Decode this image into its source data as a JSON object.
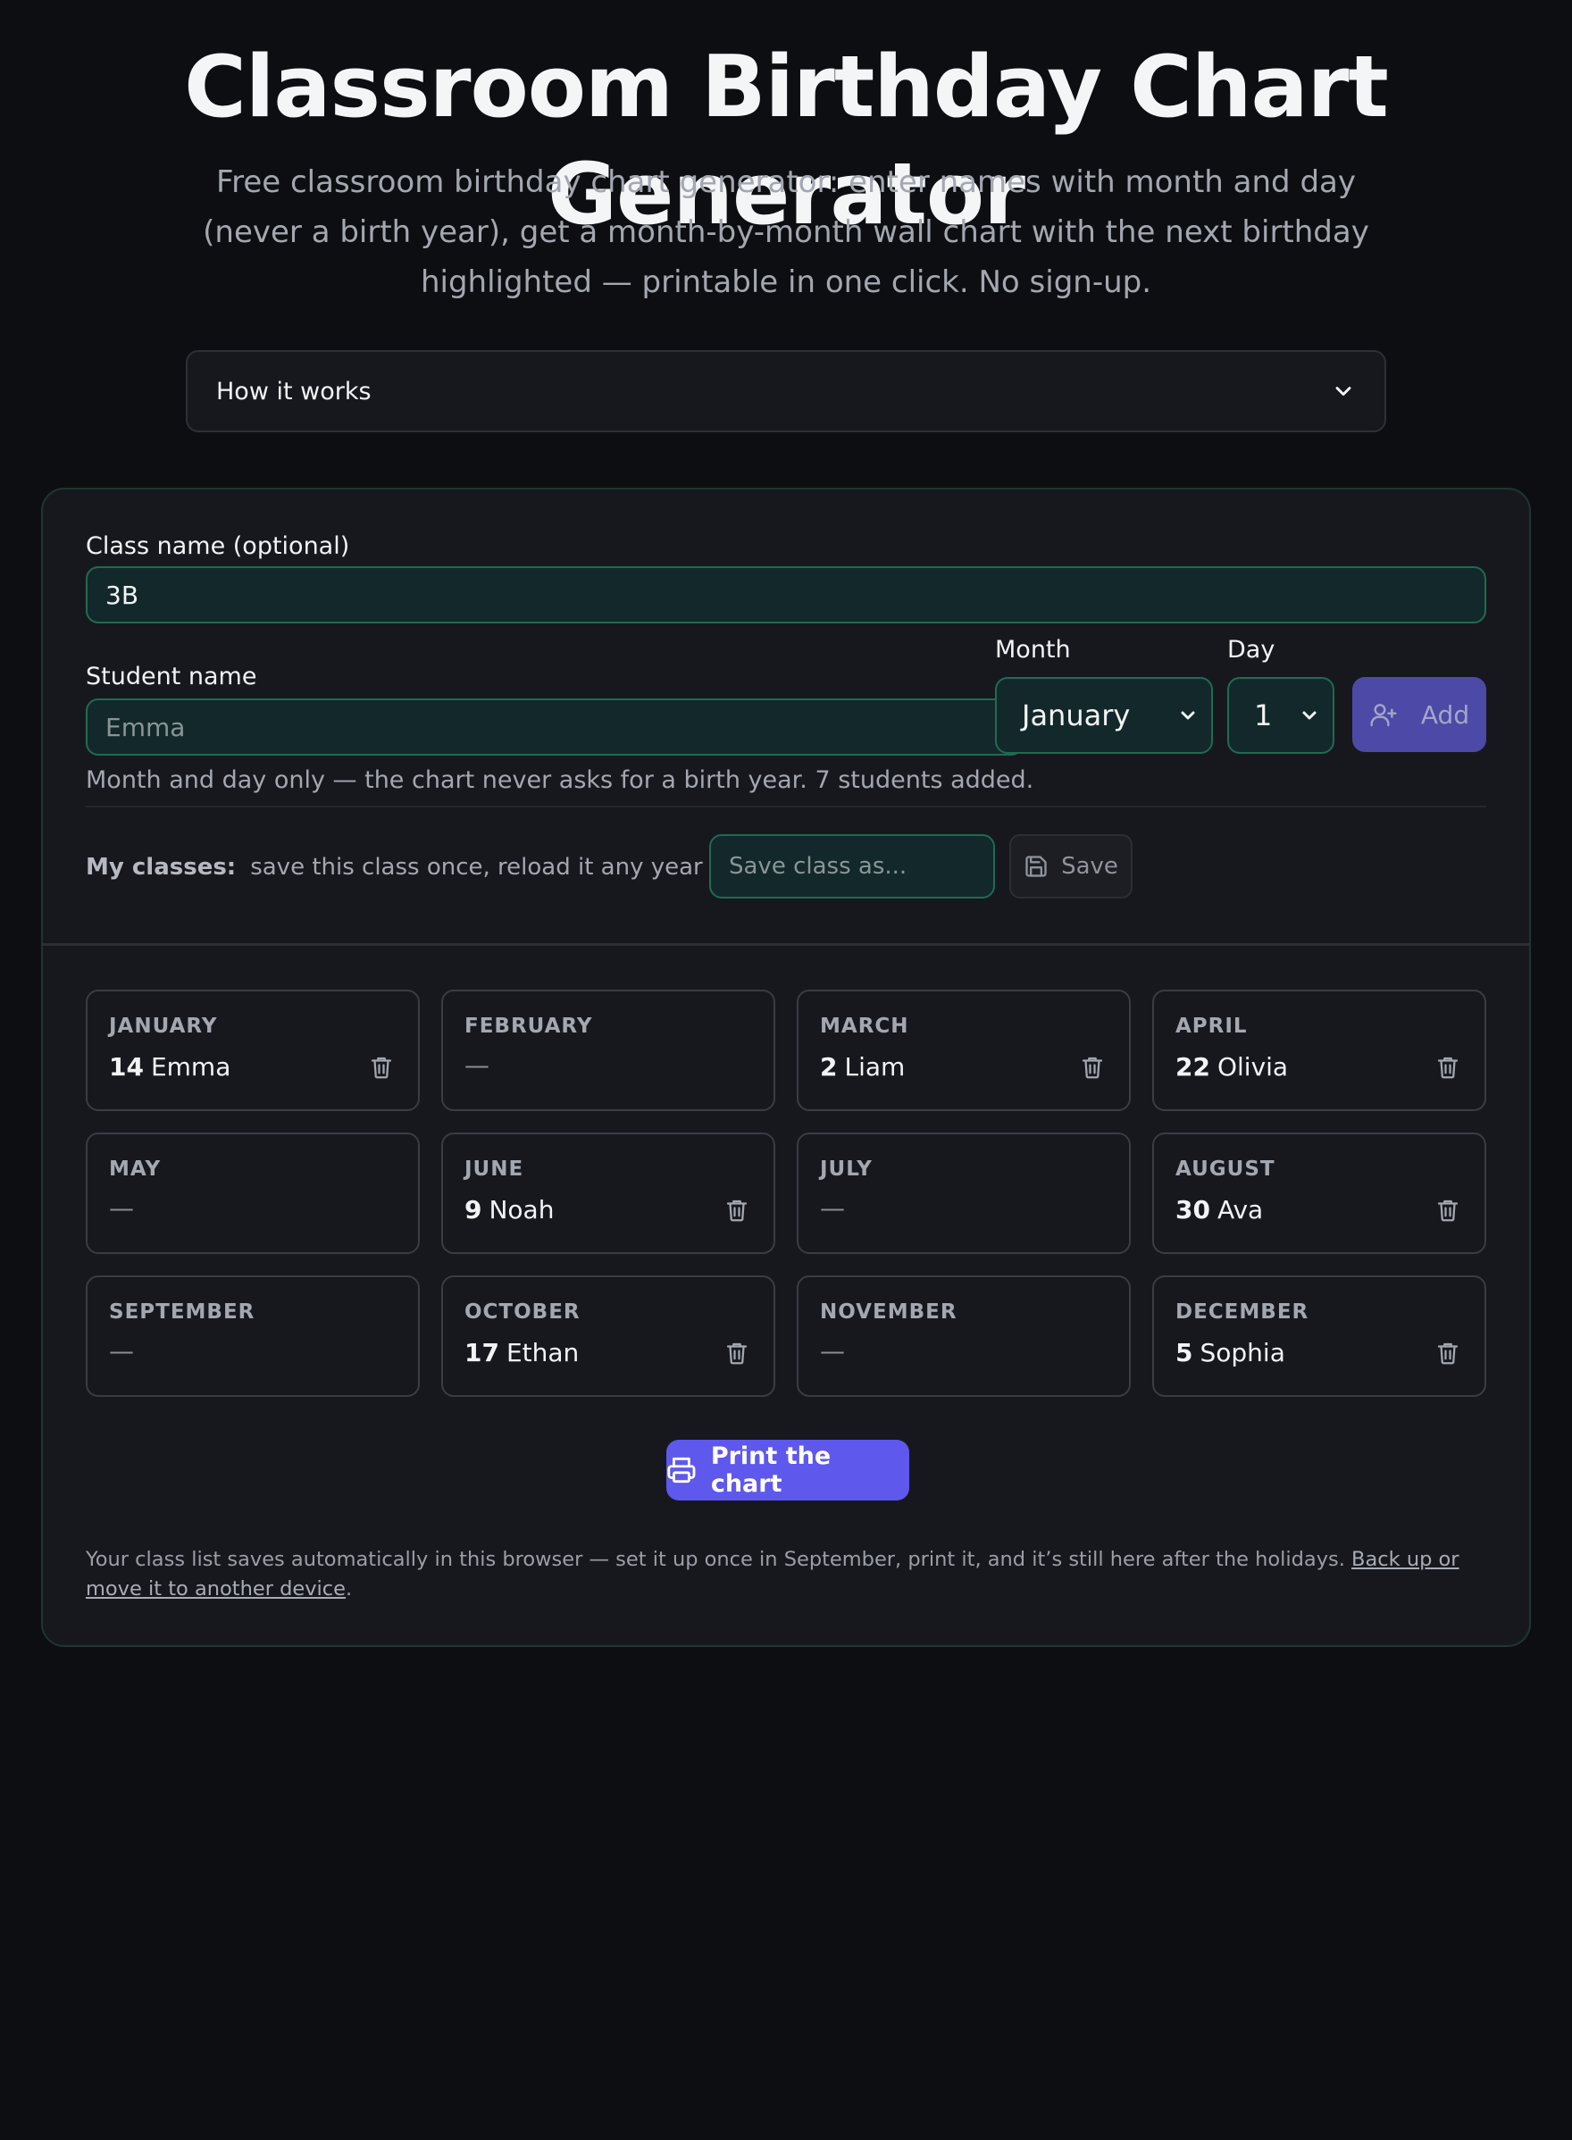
{
  "header": {
    "title": "Classroom Birthday Chart Generator",
    "subtitle": "Free classroom birthday chart generator: enter names with month and day (never a birth year), get a month-by-month wall chart with the next birthday highlighted — printable in one click. No sign-up."
  },
  "how_it_works": {
    "label": "How it works"
  },
  "form": {
    "class_name_label": "Class name (optional)",
    "class_name_value": "3B",
    "student_name_label": "Student name",
    "student_name_placeholder": "Emma",
    "month_label": "Month",
    "month_value": "January",
    "day_label": "Day",
    "day_value": "1",
    "add_label": "Add",
    "hint": "Month and day only — the chart never asks for a birth year. 7 students added."
  },
  "my_classes": {
    "label": "My classes:",
    "text": "save this class once, reload it any year —",
    "save_as_placeholder": "Save class as...",
    "save_label": "Save"
  },
  "months": [
    {
      "name": "JANUARY",
      "day": "14",
      "student": "Emma",
      "empty": ""
    },
    {
      "name": "FEBRUARY",
      "day": "",
      "student": "",
      "empty": "—"
    },
    {
      "name": "MARCH",
      "day": "2",
      "student": "Liam",
      "empty": ""
    },
    {
      "name": "APRIL",
      "day": "22",
      "student": "Olivia",
      "empty": ""
    },
    {
      "name": "MAY",
      "day": "",
      "student": "",
      "empty": "—"
    },
    {
      "name": "JUNE",
      "day": "9",
      "student": "Noah",
      "empty": ""
    },
    {
      "name": "JULY",
      "day": "",
      "student": "",
      "empty": "—"
    },
    {
      "name": "AUGUST",
      "day": "30",
      "student": "Ava",
      "empty": ""
    },
    {
      "name": "SEPTEMBER",
      "day": "",
      "student": "",
      "empty": "—"
    },
    {
      "name": "OCTOBER",
      "day": "17",
      "student": "Ethan",
      "empty": ""
    },
    {
      "name": "NOVEMBER",
      "day": "",
      "student": "",
      "empty": "—"
    },
    {
      "name": "DECEMBER",
      "day": "5",
      "student": "Sophia",
      "empty": ""
    }
  ],
  "print": {
    "label": "Print the chart"
  },
  "footer": {
    "text": "Your class list saves automatically in this browser — set it up once in September, print it, and it’s still here after the holidays.",
    "link": "Back up or move it to another device",
    "end": "."
  },
  "colors": {
    "background": "#0d0e12",
    "card": "#17181e",
    "input_fill": "#13282a",
    "input_border": "#1f6b52",
    "accent": "#5e58ec",
    "add_button": "#4c4aa6"
  },
  "icons": {
    "how_it_works": "chevron-down-icon",
    "add": "user-plus-icon",
    "save": "floppy-disk-icon",
    "remove": "trash-icon",
    "print": "printer-icon"
  }
}
